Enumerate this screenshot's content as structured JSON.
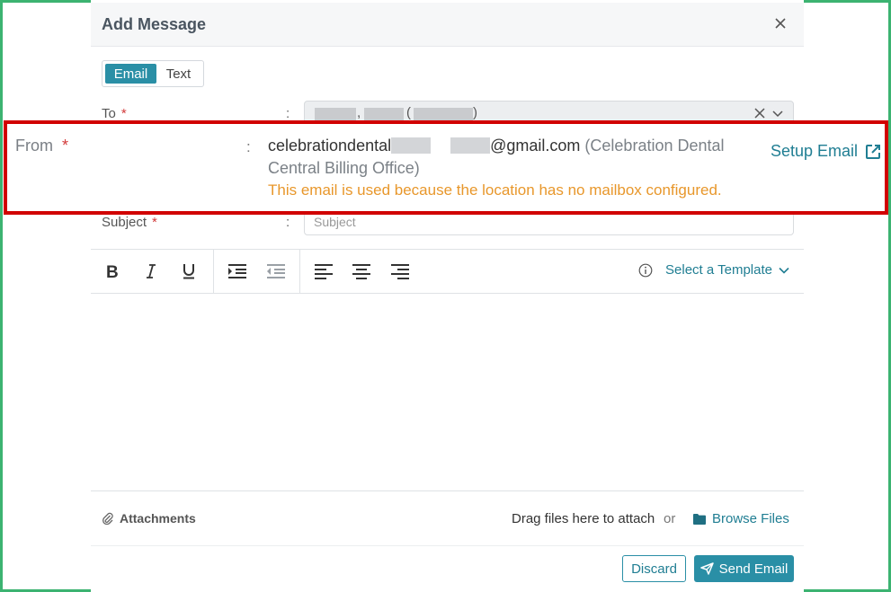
{
  "dialog": {
    "title": "Add Message",
    "close_icon": "close-icon"
  },
  "mode_toggle": {
    "options": [
      "Email",
      "Text"
    ],
    "selected": "Email"
  },
  "to": {
    "label": "To",
    "required_mark": "*",
    "colon": ":",
    "visible_chars": {
      "comma": ",",
      "paren_open": "(",
      "paren_close": ")"
    }
  },
  "from": {
    "label": "From",
    "required_mark": "*",
    "colon": ":",
    "email_prefix": "celebrationdental",
    "email_suffix": "@gmail.com",
    "name_part1": "(Celebration Dental",
    "name_part2": "Central Billing Office)",
    "warning": "This email is used because the location has no mailbox configured.",
    "setup_link": "Setup Email"
  },
  "subject": {
    "label": "Subject",
    "required_mark": "*",
    "colon": ":",
    "placeholder": "Subject",
    "value": ""
  },
  "toolbar": {
    "buttons": [
      "bold-icon",
      "italic-icon",
      "underline-icon",
      "indent-icon",
      "outdent-icon",
      "align-left-icon",
      "align-center-icon",
      "align-right-icon"
    ],
    "template_label": "Select a Template"
  },
  "attachments": {
    "label": "Attachments",
    "drag_text": "Drag files here to attach",
    "or_text": "or",
    "browse_label": "Browse Files"
  },
  "actions": {
    "discard_label": "Discard",
    "send_label": "Send Email"
  },
  "colors": {
    "accent": "#2a8fa6",
    "link": "#207e93",
    "required": "#d23b3b",
    "warning": "#e8972b",
    "highlight_border": "#d10000",
    "frame_border": "#3cb371"
  }
}
